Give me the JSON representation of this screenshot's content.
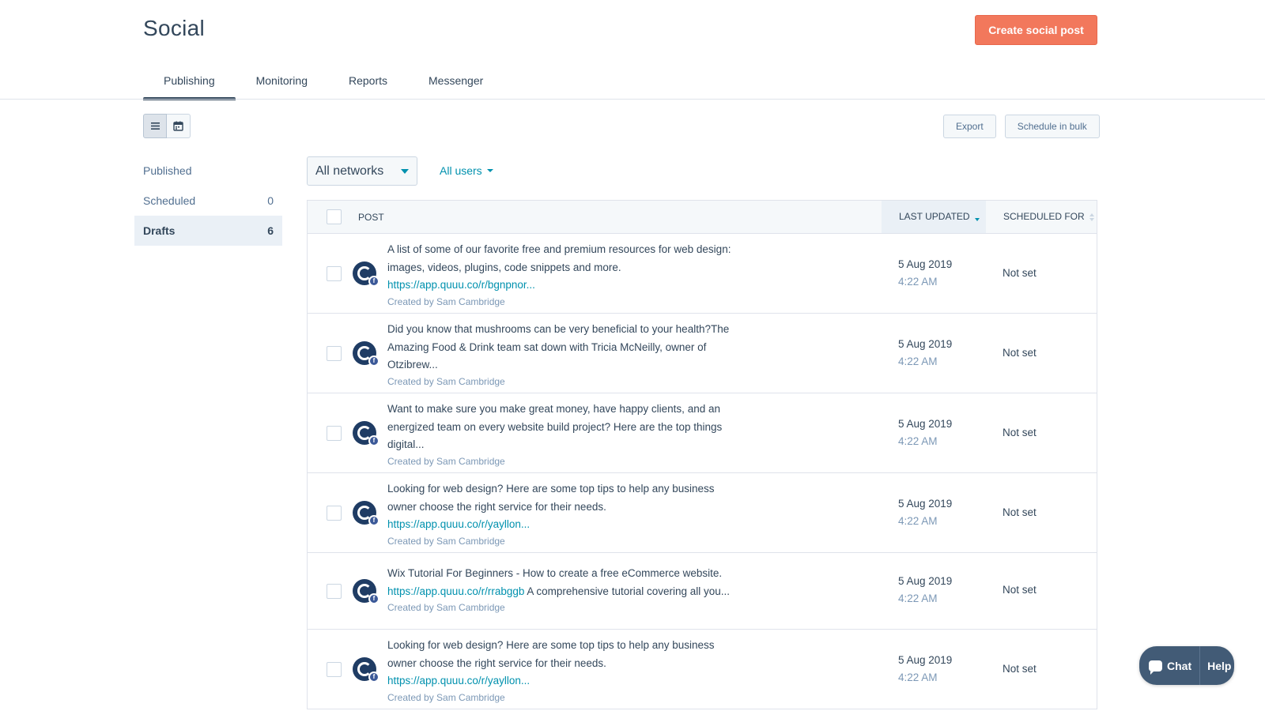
{
  "header": {
    "title": "Social",
    "create_button": "Create social post"
  },
  "tabs": [
    {
      "label": "Publishing",
      "active": true
    },
    {
      "label": "Monitoring",
      "active": false
    },
    {
      "label": "Reports",
      "active": false
    },
    {
      "label": "Messenger",
      "active": false
    }
  ],
  "view_toggle": {
    "active": "list",
    "icons": [
      "list-icon",
      "calendar-icon"
    ]
  },
  "actions": {
    "export": "Export",
    "schedule_bulk": "Schedule in bulk"
  },
  "sidebar": {
    "items": [
      {
        "label": "Published",
        "count": ""
      },
      {
        "label": "Scheduled",
        "count": "0"
      },
      {
        "label": "Drafts",
        "count": "6",
        "active": true
      }
    ]
  },
  "filters": {
    "network": "All networks",
    "users": "All users"
  },
  "table": {
    "columns": {
      "post": "Post",
      "last_updated": "Last updated",
      "scheduled_for": "Scheduled for"
    },
    "rows": [
      {
        "text": "A list of some of our favorite free and premium resources for web design: images, videos, plugins, code snippets and more. ",
        "link": "https://app.quuu.co/r/bgnpnor...",
        "created_by": "Created by Sam Cambridge",
        "date": "5 Aug 2019",
        "time": "4:22 AM",
        "scheduled": "Not set"
      },
      {
        "text": "Did you know that mushrooms can be very beneficial to your health?The Amazing Food & Drink team sat down with Tricia McNeilly, owner of Otzibrew...",
        "link": "",
        "created_by": "Created by Sam Cambridge",
        "date": "5 Aug 2019",
        "time": "4:22 AM",
        "scheduled": "Not set"
      },
      {
        "text": "Want to make sure you make great money, have happy clients, and an energized team on every website build project? Here are the top things digital...",
        "link": "",
        "created_by": "Created by Sam Cambridge",
        "date": "5 Aug 2019",
        "time": "4:22 AM",
        "scheduled": "Not set"
      },
      {
        "text": "Looking for web design? Here are some top tips to help any business owner choose the right service for their needs. ",
        "link": "https://app.quuu.co/r/yayllon...",
        "created_by": "Created by Sam Cambridge",
        "date": "5 Aug 2019",
        "time": "4:22 AM",
        "scheduled": "Not set"
      },
      {
        "text": "Wix Tutorial For Beginners - How to create a free eCommerce website. ",
        "link": "https://app.quuu.co/r/rrabggb",
        "text_after": " A comprehensive tutorial covering all you...",
        "created_by": "Created by Sam Cambridge",
        "date": "5 Aug 2019",
        "time": "4:22 AM",
        "scheduled": "Not set"
      },
      {
        "text": "Looking for web design? Here are some top tips to help any business owner choose the right service for their needs. ",
        "link": "https://app.quuu.co/r/yayllon...",
        "created_by": "Created by Sam Cambridge",
        "date": "5 Aug 2019",
        "time": "4:22 AM",
        "scheduled": "Not set"
      }
    ]
  },
  "chat_widget": {
    "chat": "Chat",
    "help": "Help"
  },
  "colors": {
    "primary": "#f2785c",
    "link": "#0091ae",
    "text": "#33475b",
    "avatar": "#1f3c64",
    "facebook": "#3b5998"
  }
}
